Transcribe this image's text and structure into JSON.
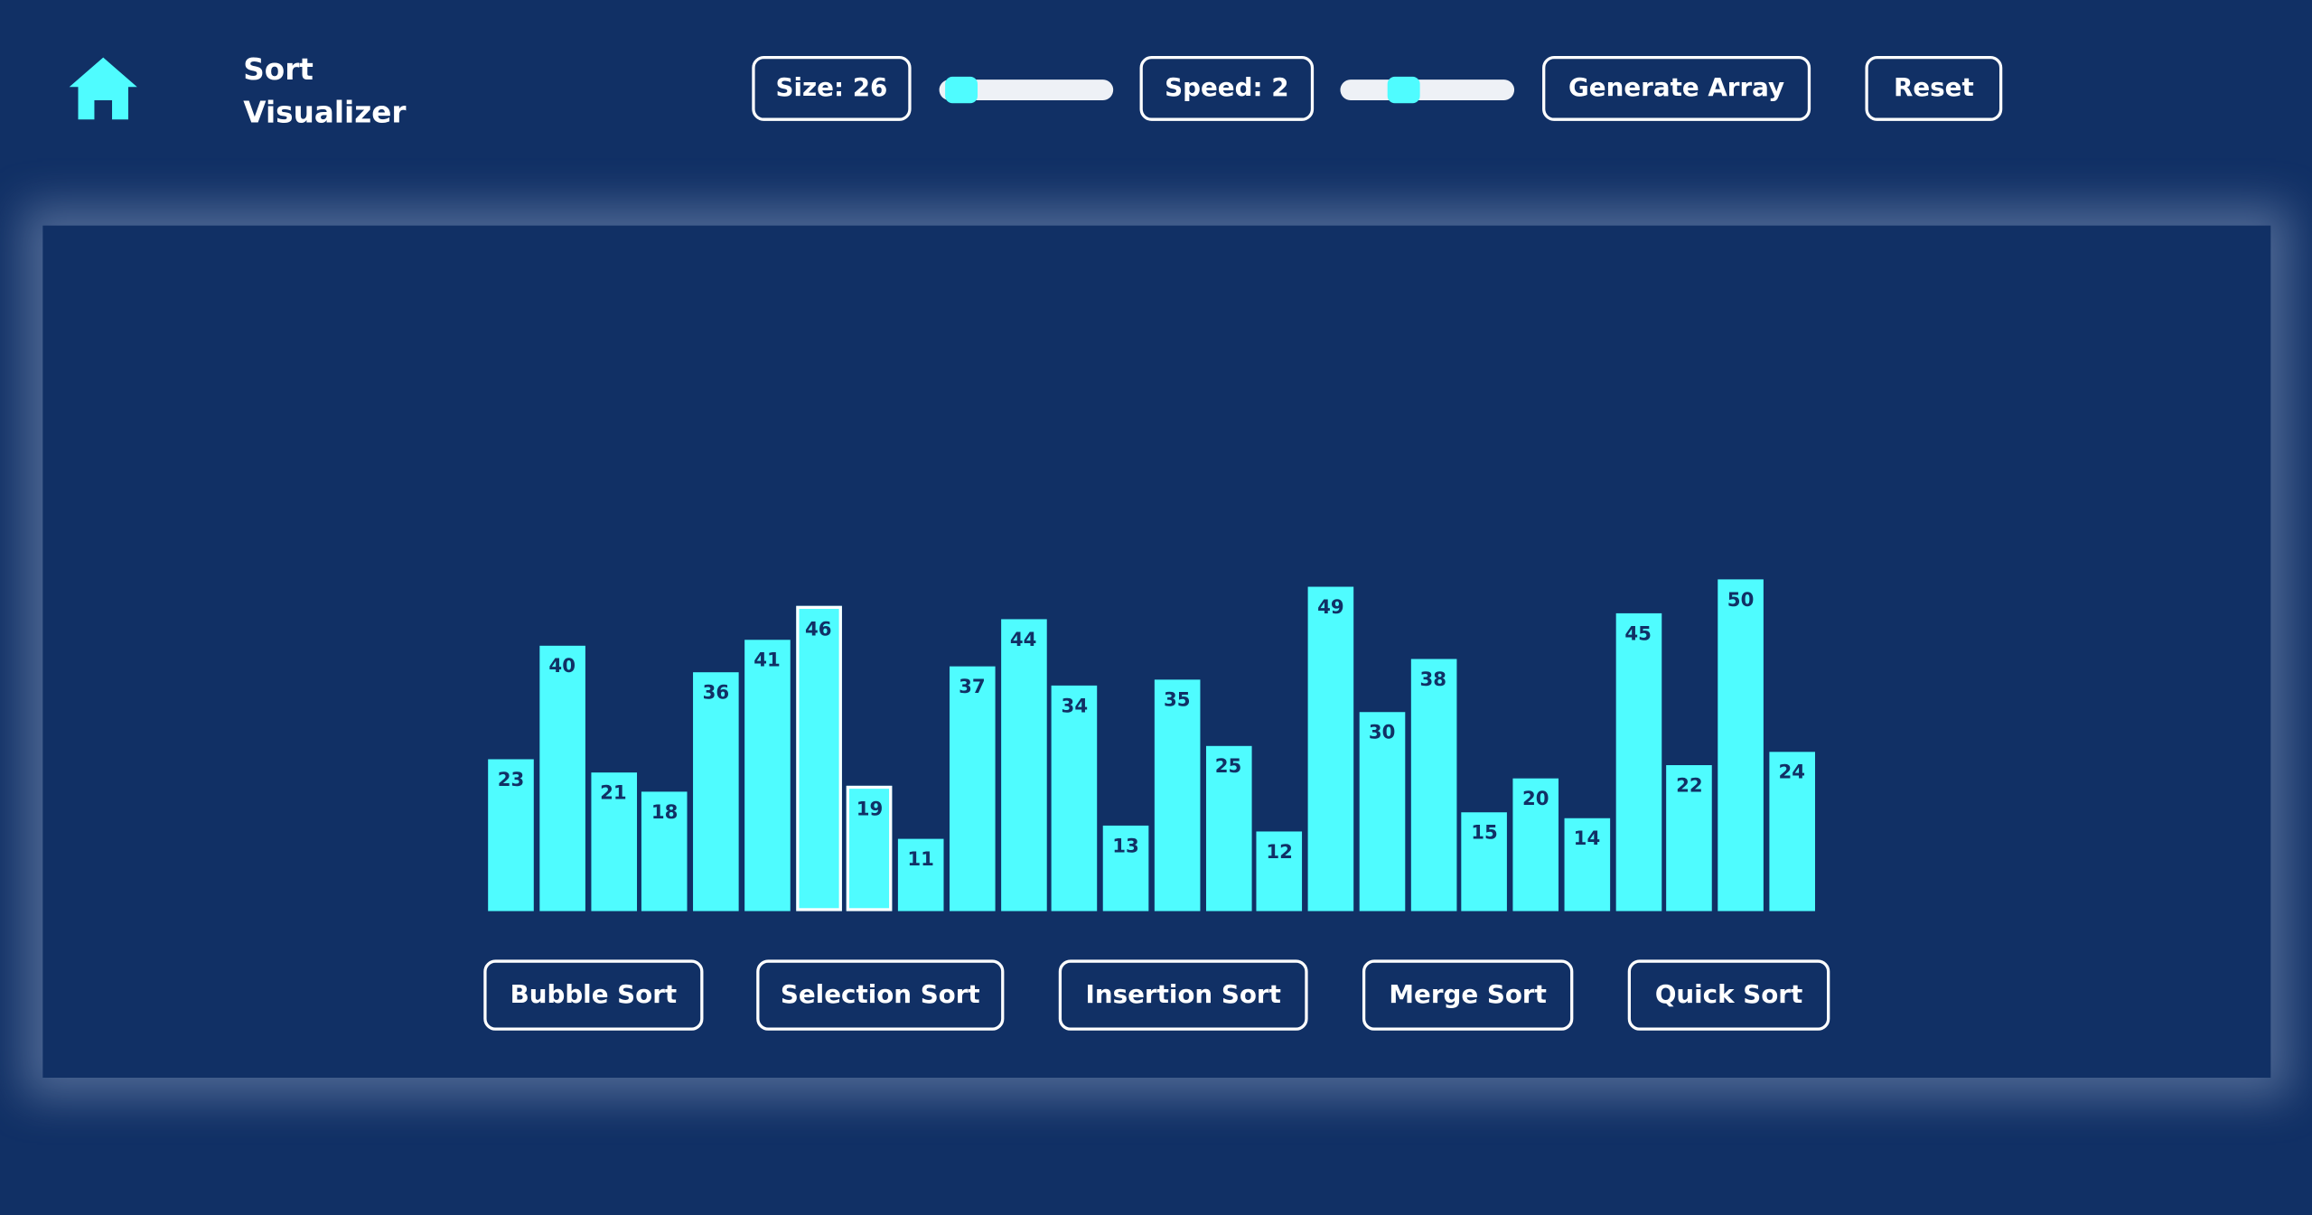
{
  "header": {
    "home_icon": "home-icon",
    "title_line1": "Sort",
    "title_line2": "Visualizer"
  },
  "controls": {
    "size_label": "Size: 26",
    "size_slider_value": 0.04,
    "speed_label": "Speed: 2",
    "speed_slider_value": 0.33,
    "generate_label": "Generate Array",
    "reset_label": "Reset"
  },
  "array": {
    "values": [
      23,
      40,
      21,
      18,
      36,
      41,
      46,
      19,
      11,
      37,
      44,
      34,
      13,
      35,
      25,
      12,
      49,
      30,
      38,
      15,
      20,
      14,
      45,
      22,
      50,
      24
    ],
    "active_indices": [
      6,
      7
    ]
  },
  "algorithms": [
    {
      "label": "Bubble Sort"
    },
    {
      "label": "Selection Sort"
    },
    {
      "label": "Insertion Sort"
    },
    {
      "label": "Merge Sort"
    },
    {
      "label": "Quick Sort"
    }
  ],
  "colors": {
    "background": "#113065",
    "accent": "#4ffcff",
    "bar_text": "#113065",
    "border": "#ffffff",
    "slider_track": "#eef1f6"
  }
}
